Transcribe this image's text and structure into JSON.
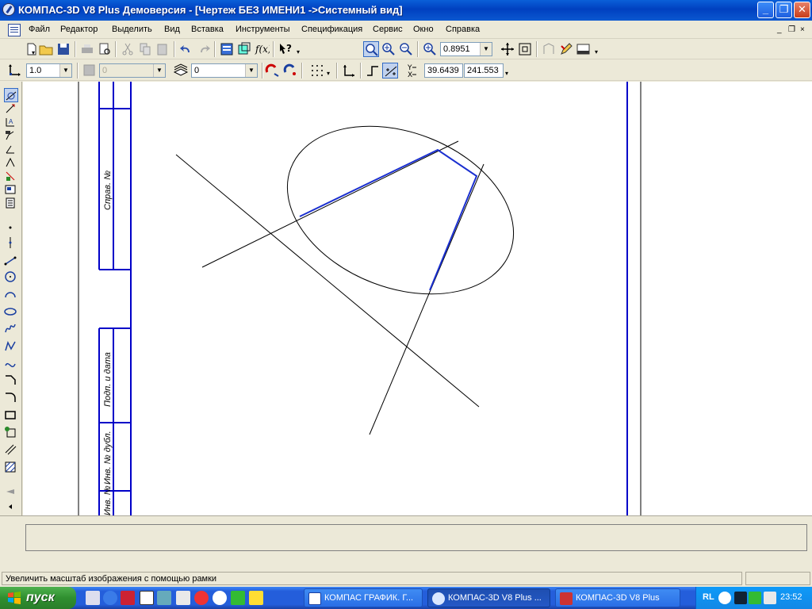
{
  "window": {
    "title": "КОМПАС-3D V8 Plus Демоверсия - [Чертеж БЕЗ ИМЕНИ1  ->Системный вид]",
    "minimize_label": "_",
    "maximize_label": "❐",
    "close_label": "✕"
  },
  "menu": {
    "items": [
      "Файл",
      "Редактор",
      "Выделить",
      "Вид",
      "Вставка",
      "Инструменты",
      "Спецификация",
      "Сервис",
      "Окно",
      "Справка"
    ],
    "mdi_minimize": "_",
    "mdi_restore": "❐",
    "mdi_close": "×"
  },
  "toolbar1": {
    "zoom_value": "0.8951"
  },
  "toolbar2": {
    "scale_value": "1.0",
    "layer_value": "0",
    "style_value": "0",
    "coord_label": "Yₓ",
    "coord_x": "39.6439",
    "coord_y": "241.553"
  },
  "frame_labels": {
    "sprav": "Справ. №",
    "podp": "Подп. и дата",
    "inv_dubl": "Инв. № дубл.",
    "inv": "Инв. №"
  },
  "status": {
    "text": "Увеличить масштаб изображения с помощью рамки"
  },
  "taskbar": {
    "start_label": "пуск",
    "tasks": [
      {
        "label": "КОМПАС ГРАФИК. Г...",
        "active": false
      },
      {
        "label": "КОМПАС-3D V8 Plus ...",
        "active": true
      },
      {
        "label": "КОМПАС-3D V8  Plus",
        "active": false
      }
    ],
    "lang": "RL",
    "clock": "23:52"
  },
  "colors": {
    "frame_blue": "#0000c8",
    "selection_blue": "#1a2fd0",
    "geometry": "#000000"
  }
}
